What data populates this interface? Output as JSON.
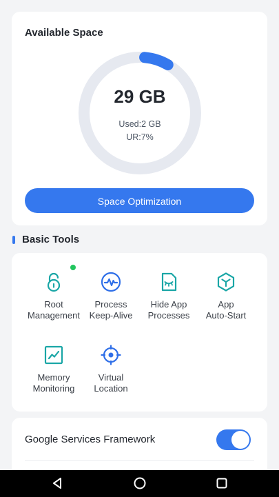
{
  "space": {
    "title": "Available Space",
    "available": "29 GB",
    "used": "Used:2 GB",
    "usage_ratio": "UR:7%",
    "usage_fraction": 0.07,
    "button_label": "Space Optimization"
  },
  "basic_tools": {
    "title": "Basic Tools",
    "items": [
      {
        "label": "Root\nManagement",
        "icon": "unlock-icon",
        "badge": true
      },
      {
        "label": "Process\nKeep-Alive",
        "icon": "pulse-icon",
        "badge": false
      },
      {
        "label": "Hide App\nProcesses",
        "icon": "hidden-file-icon",
        "badge": false
      },
      {
        "label": "App\nAuto-Start",
        "icon": "cube-icon",
        "badge": false
      },
      {
        "label": "Memory\nMonitoring",
        "icon": "chart-icon",
        "badge": false
      },
      {
        "label": "Virtual\nLocation",
        "icon": "crosshair-icon",
        "badge": false
      }
    ]
  },
  "toggles": {
    "gsf_label": "Google Services Framework",
    "gsf_enabled": true
  },
  "colors": {
    "accent": "#3578ee",
    "icon_teal": "#1aa6a6",
    "ring_bg": "#e6e9f0",
    "badge": "#22c55e"
  }
}
